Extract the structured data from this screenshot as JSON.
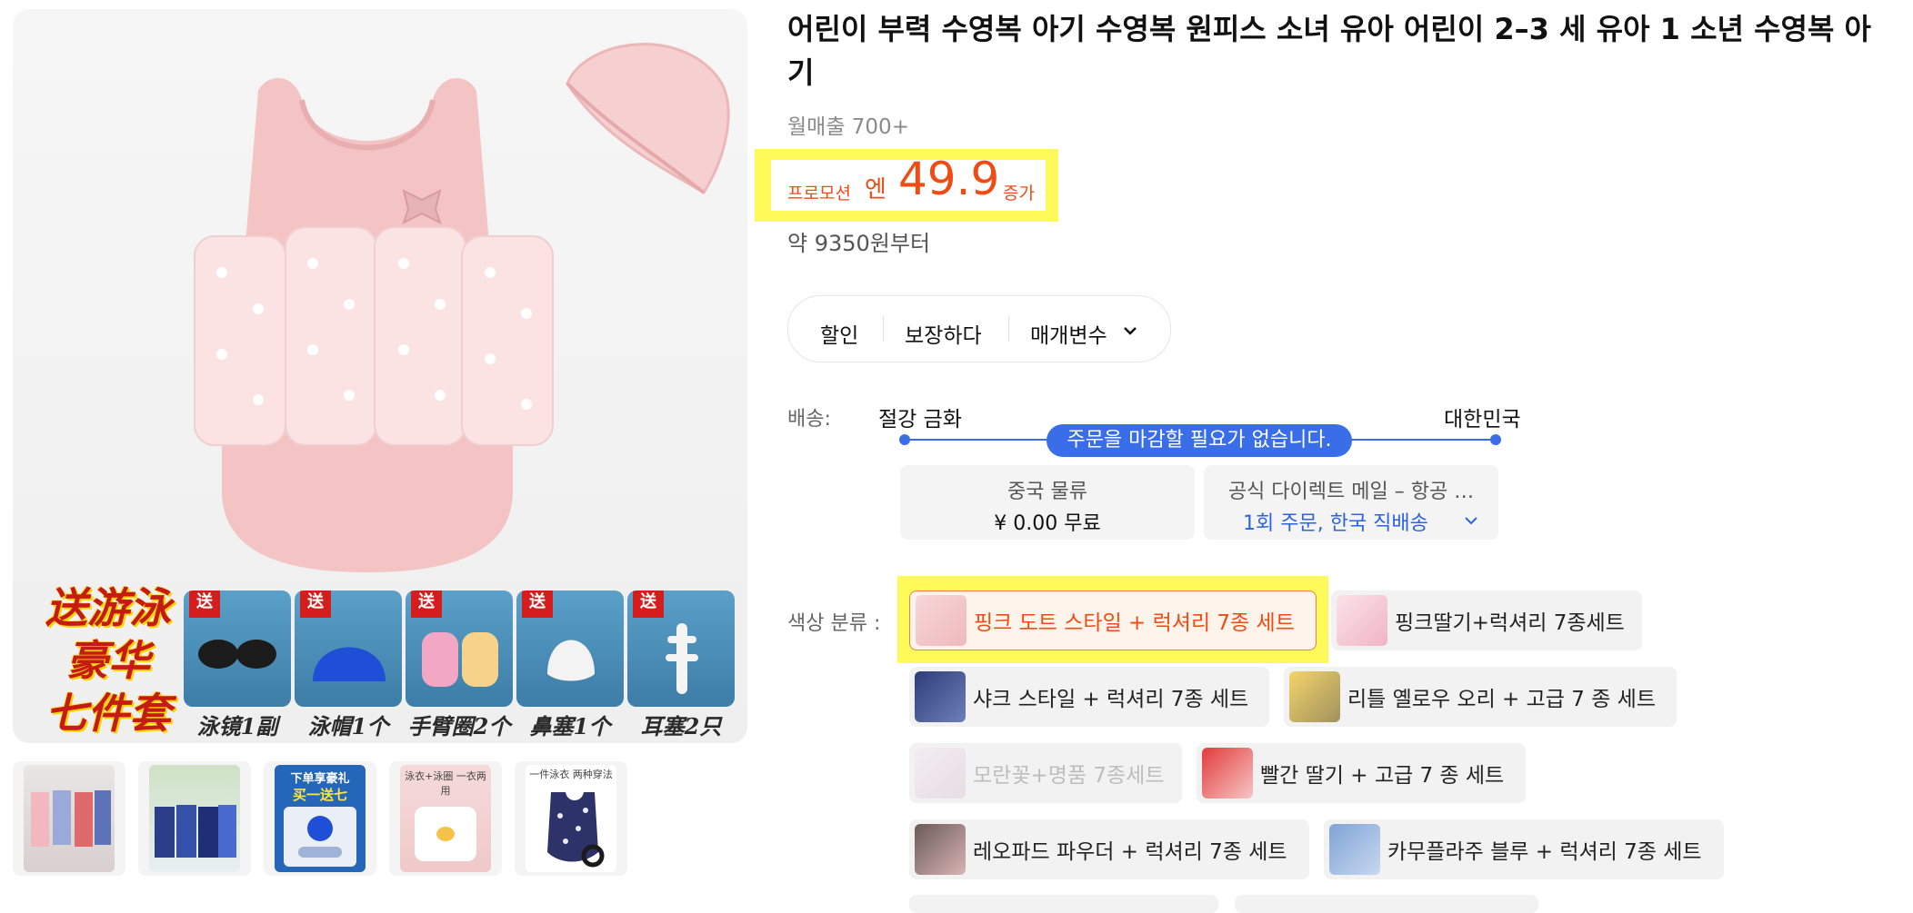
{
  "gallery": {
    "promo_text": [
      "送游泳",
      "豪华",
      "七件套"
    ],
    "gift_badge": "送",
    "accessories": [
      {
        "label": "泳镜1副",
        "icon": "goggles-icon"
      },
      {
        "label": "泳帽1个",
        "icon": "swim-cap-icon"
      },
      {
        "label": "手臂圈2个",
        "icon": "arm-floats-icon"
      },
      {
        "label": "鼻塞1个",
        "icon": "nose-clip-icon"
      },
      {
        "label": "耳塞2只",
        "icon": "ear-plugs-icon"
      }
    ],
    "thumbnail_texts": {
      "thumb_3_line1": "下单享豪礼",
      "thumb_3_line2": "买一送七",
      "thumb_4_line1": "泳衣+泳圈",
      "thumb_4_line2": "一衣两用",
      "thumb_5_line1": "一件泳衣",
      "thumb_5_line2": "两种穿法"
    }
  },
  "product": {
    "title": "어린이 부력 수영복 아기 수영복 원피스 소녀 유아 어린이 2–3 세 유아 1 소년 수영복 아기",
    "monthly_sales": "월매출 700+",
    "price": {
      "prefix": "프로모션",
      "currency": "엔",
      "value": "49.9",
      "suffix": "증가",
      "approx": "약 9350원부터"
    }
  },
  "tabs": [
    {
      "label": "할인"
    },
    {
      "label": "보장하다"
    },
    {
      "label": "매개변수"
    }
  ],
  "shipping": {
    "label": "배송:",
    "from": "절강 금화",
    "to": "대한민국",
    "notice": "주문을 마감할 필요가 없습니다.",
    "china_logistics_title": "중국 물류",
    "china_logistics_value": "¥ 0.00 무료",
    "direct_mail_title": "공식 다이렉트 메일 – 항공 …",
    "direct_mail_link": "1회 주문, 한국 직배송"
  },
  "colors": {
    "label": "색상 분류 :",
    "options": [
      {
        "label": "핑크 도트 스타일 + 럭셔리 7종 세트",
        "selected": true
      },
      {
        "label": "핑크딸기+럭셔리 7종세트"
      },
      {
        "label": "샤크 스타일 + 럭셔리 7종 세트"
      },
      {
        "label": "리틀 옐로우 오리 + 고급 7 종 세트"
      },
      {
        "label": "모란꽃+명품 7종세트",
        "disabled": true
      },
      {
        "label": "빨간 딸기 + 고급 7 종 세트"
      },
      {
        "label": "레오파드 파우더 + 럭셔리 7종 세트"
      },
      {
        "label": "카무플라주 블루 + 럭셔리 7종 세트"
      }
    ]
  },
  "theme": {
    "price_color": "#f14b14",
    "highlight_color": "#fff95a",
    "link_color": "#2c63e0",
    "route_color": "#3a6ee8"
  }
}
